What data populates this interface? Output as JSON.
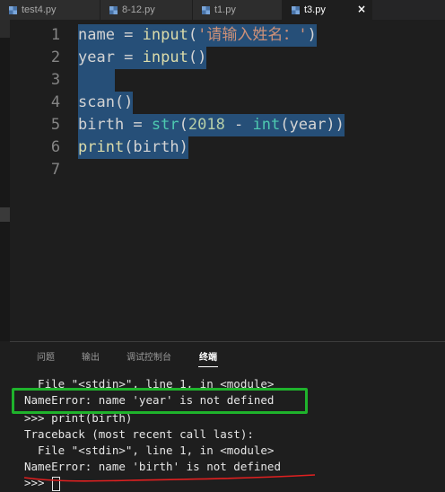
{
  "tabs": [
    {
      "label": "test4.py",
      "active": false
    },
    {
      "label": "8-12.py",
      "active": false
    },
    {
      "label": "t1.py",
      "active": false
    },
    {
      "label": "t3.py",
      "active": true
    }
  ],
  "close_label": "×",
  "colors": {
    "accent_select": "#264f78",
    "box": "#1fb32c",
    "underline": "#e02020"
  },
  "editor": {
    "lines": [
      {
        "n": "1",
        "segs": [
          [
            "",
            "name = "
          ],
          [
            "kw",
            "input"
          ],
          [
            "",
            "("
          ],
          [
            "str",
            "'请输入姓名：'"
          ],
          [
            "",
            ")"
          ]
        ]
      },
      {
        "n": "2",
        "segs": [
          [
            "",
            "year = "
          ],
          [
            "kw",
            "input"
          ],
          [
            "",
            "()"
          ]
        ]
      },
      {
        "n": "3",
        "segs": [
          [
            "",
            "    "
          ]
        ]
      },
      {
        "n": "4",
        "segs": [
          [
            "",
            "scan()"
          ]
        ]
      },
      {
        "n": "5",
        "segs": [
          [
            "",
            "birth = "
          ],
          [
            "bi",
            "str"
          ],
          [
            "",
            "("
          ],
          [
            "num",
            "2018"
          ],
          [
            "",
            " - "
          ],
          [
            "bi",
            "int"
          ],
          [
            "",
            "(year))"
          ]
        ]
      },
      {
        "n": "6",
        "segs": [
          [
            "kw",
            "print"
          ],
          [
            "",
            "(birth)"
          ]
        ]
      },
      {
        "n": "7",
        "segs": []
      }
    ]
  },
  "panel": {
    "tabs": [
      "问题",
      "输出",
      "调试控制台",
      "终端"
    ],
    "active_tab": "终端",
    "terminal": [
      "  File \"<stdin>\", line 1, in <module>",
      "NameError: name 'year' is not defined",
      ">>> print(birth)",
      "Traceback (most recent call last):",
      "  File \"<stdin>\", line 1, in <module>",
      "NameError: name 'birth' is not defined",
      ">>> "
    ]
  }
}
